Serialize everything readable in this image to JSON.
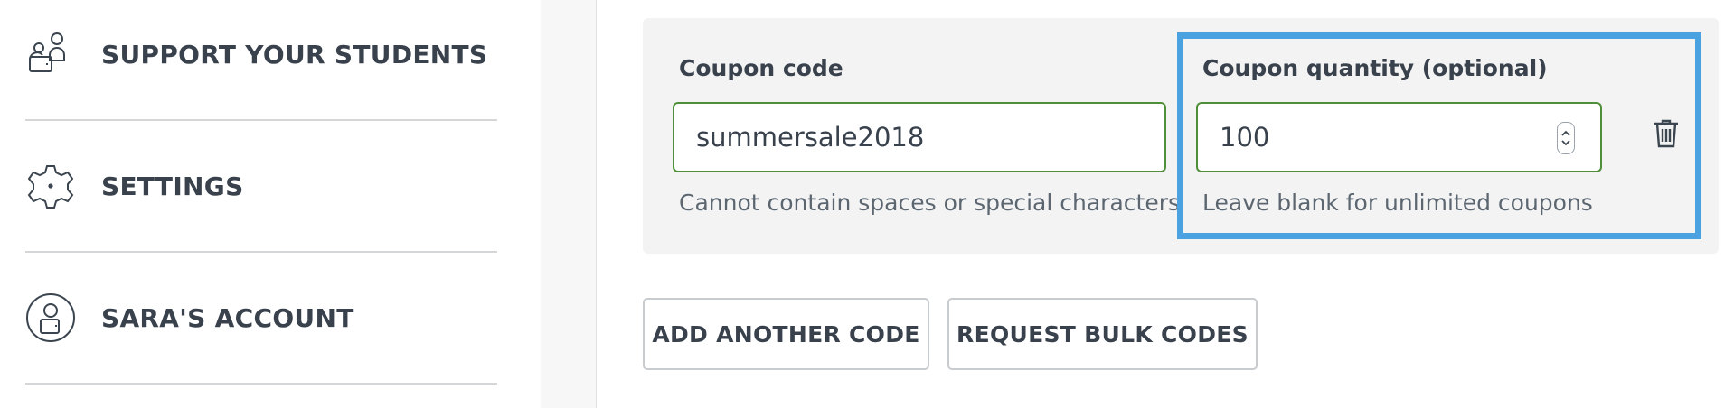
{
  "sidebar": {
    "items": [
      {
        "label": "SUPPORT YOUR STUDENTS",
        "icon": "students-icon"
      },
      {
        "label": "SETTINGS",
        "icon": "gear-icon"
      },
      {
        "label": "SARA'S ACCOUNT",
        "icon": "account-icon"
      }
    ]
  },
  "coupon": {
    "code_label": "Coupon code",
    "code_value": "summersale2018",
    "code_hint": "Cannot contain spaces or special characters",
    "quantity_label": "Coupon quantity (optional)",
    "quantity_value": "100",
    "quantity_hint": "Leave blank for unlimited coupons"
  },
  "actions": {
    "add_another": "ADD ANOTHER CODE",
    "request_bulk": "REQUEST BULK CODES"
  },
  "colors": {
    "input_border": "#4f8f3a",
    "highlight": "#4aa3e0",
    "text": "#38414c"
  }
}
